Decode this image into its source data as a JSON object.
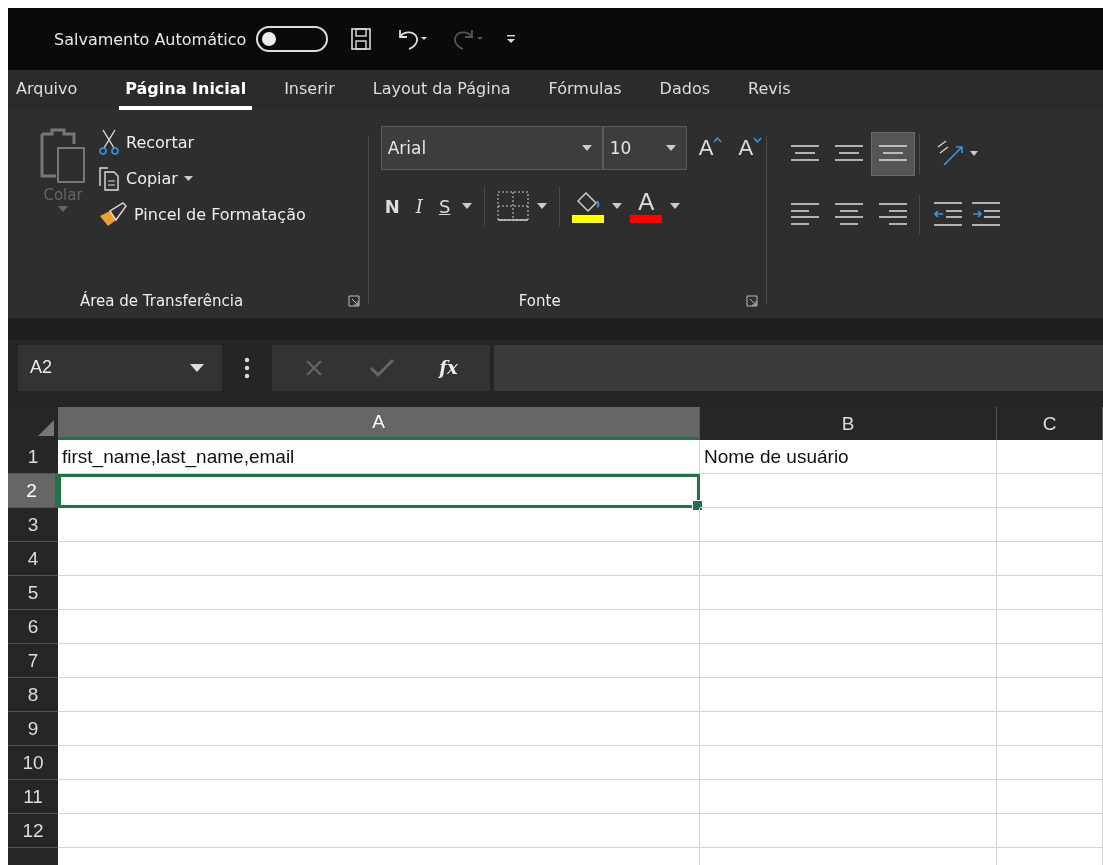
{
  "quick_access": {
    "autosave_label": "Salvamento Automático",
    "autosave_on": false,
    "redo_disabled": true
  },
  "tabs": [
    {
      "label": "Arquivo",
      "selected": false
    },
    {
      "label": "Página Inicial",
      "selected": true
    },
    {
      "label": "Inserir",
      "selected": false
    },
    {
      "label": "Layout da Página",
      "selected": false
    },
    {
      "label": "Fórmulas",
      "selected": false
    },
    {
      "label": "Dados",
      "selected": false
    },
    {
      "label": "Revis",
      "selected": false
    }
  ],
  "ribbon": {
    "clipboard": {
      "label": "Área de Transferência",
      "paste": {
        "label": "Colar",
        "disabled": true
      },
      "items": [
        {
          "kind": "cut",
          "label": "Recortar"
        },
        {
          "kind": "copy",
          "label": "Copiar"
        },
        {
          "kind": "brush",
          "label": "Pincel de Formatação"
        }
      ]
    },
    "font": {
      "label": "Fonte",
      "font_name": "Arial",
      "font_size": "10",
      "grow": "A",
      "shrink": "A",
      "bold": "N",
      "italic": "I",
      "underline": "S",
      "font_color_letter": "A"
    },
    "alignment": {
      "buttons": [
        {
          "kind": "top",
          "selected": false
        },
        {
          "kind": "middle",
          "selected": false
        },
        {
          "kind": "bottom",
          "selected": true
        },
        {
          "kind": "left",
          "selected": false
        },
        {
          "kind": "center",
          "selected": false
        },
        {
          "kind": "right",
          "selected": false
        }
      ]
    }
  },
  "formula_bar": {
    "name_box": "A2",
    "fx": "fx"
  },
  "sheet": {
    "columns": [
      {
        "label": "A",
        "selected": true
      },
      {
        "label": "B",
        "selected": false
      },
      {
        "label": "C",
        "selected": false
      }
    ],
    "rows": [
      {
        "label": "1",
        "selected": false,
        "cells": [
          "first_name,last_name,email",
          "Nome de usuário"
        ]
      },
      {
        "label": "2",
        "selected": true
      },
      {
        "label": "3",
        "selected": false
      },
      {
        "label": "4",
        "selected": false
      },
      {
        "label": "5",
        "selected": false
      },
      {
        "label": "6",
        "selected": false
      },
      {
        "label": "7",
        "selected": false
      },
      {
        "label": "8",
        "selected": false
      },
      {
        "label": "9",
        "selected": false
      },
      {
        "label": "10",
        "selected": false
      },
      {
        "label": "11",
        "selected": false
      },
      {
        "label": "12",
        "selected": false
      }
    ]
  }
}
